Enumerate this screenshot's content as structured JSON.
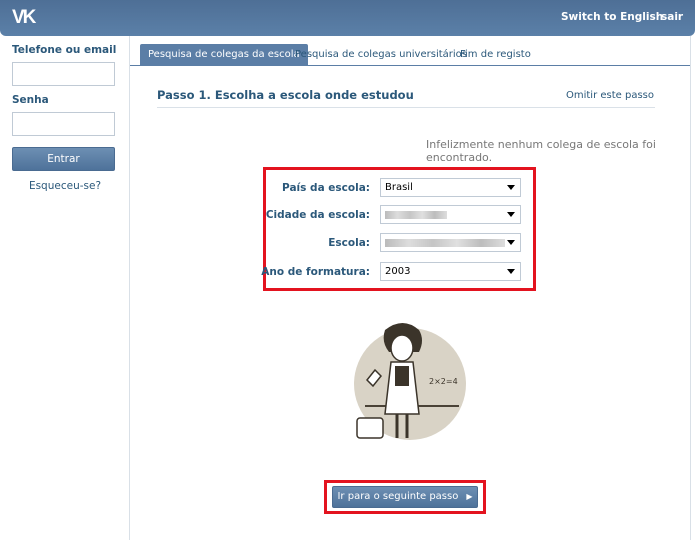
{
  "header": {
    "logo": "VK",
    "switch_language": "Switch to English",
    "logout": "sair"
  },
  "sidebar": {
    "phone_label": "Telefone ou email",
    "password_label": "Senha",
    "login_button": "Entrar",
    "forgot_link": "Esqueceu-se?"
  },
  "tabs": [
    {
      "label": "Pesquisa de colegas da escola",
      "active": true
    },
    {
      "label": "Pesquisa de colegas universitários",
      "active": false
    },
    {
      "label": "Fim de registo",
      "active": false
    }
  ],
  "step": {
    "title": "Passo 1. Escolha a escola onde estudou",
    "skip": "Omitir este passo"
  },
  "message": "Infelizmente nenhum colega de escola foi encontrado.",
  "form": {
    "country": {
      "label": "País da escola:",
      "value": "Brasil"
    },
    "city": {
      "label": "Cidade da escola:",
      "value": ""
    },
    "school": {
      "label": "Escola:",
      "value": ""
    },
    "year": {
      "label": "Ano de formatura:",
      "value": "2003"
    }
  },
  "illustration": {
    "board_text": "2×2=4"
  },
  "next_button": "Ir para o seguinte passo",
  "colors": {
    "brand": "#5b7ea6",
    "highlight": "#e3131f",
    "link": "#2b587a"
  }
}
